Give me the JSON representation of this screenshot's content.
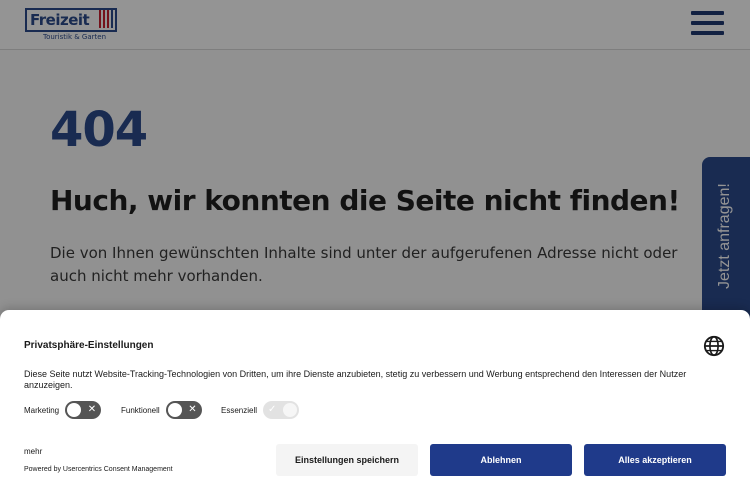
{
  "header": {
    "logo_text": "Freizeit",
    "logo_subtext": "Touristik & Garten",
    "menu_icon": "hamburger-menu-icon"
  },
  "main": {
    "error_code": "404",
    "title": "Huch, wir konnten die Seite nicht finden!",
    "text": "Die von Ihnen gewünschten Inhalte sind unter der aufgerufenen Adresse nicht oder auch nicht mehr vorhanden."
  },
  "side_tab": {
    "label": "Jetzt anfragen!"
  },
  "consent": {
    "title": "Privatsphäre-Einstellungen",
    "globe_icon": "globe-icon",
    "description": "Diese Seite nutzt Website-Tracking-Technologien von Dritten, um ihre Dienste anzubieten, stetig zu verbessern und Werbung entsprechend den Interessen der Nutzer anzuzeigen.",
    "toggles": [
      {
        "label": "Marketing",
        "enabled": false
      },
      {
        "label": "Funktionell",
        "enabled": false
      },
      {
        "label": "Essenziell",
        "enabled": true,
        "disabled": true
      }
    ],
    "more_link": "mehr",
    "powered_by": "Powered by Usercentrics Consent Management",
    "buttons": {
      "save": "Einstellungen speichern",
      "deny": "Ablehnen",
      "accept": "Alles akzeptieren"
    }
  },
  "colors": {
    "brand": "#2b4a8c",
    "button_primary": "#1f3a8a",
    "overlay": "rgba(0,0,0,0.42)"
  }
}
